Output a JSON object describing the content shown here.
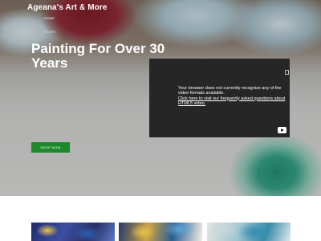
{
  "header": {
    "site_title": "Ageana's Art & More",
    "nav": [
      {
        "label": "HOME"
      },
      {
        "label": "STORE"
      }
    ]
  },
  "hero": {
    "headline": "Painting For Over 30 Years",
    "cta_label": "SHOP NOW"
  },
  "video": {
    "message": "Your browser does not currently recognize any of the video formats available.",
    "help_link": "Click here to visit our frequently asked questions about HTML5 video.",
    "play_icon": "youtube-icon"
  },
  "colors": {
    "cta_background": "#1c8a2a",
    "video_background": "#262626"
  }
}
